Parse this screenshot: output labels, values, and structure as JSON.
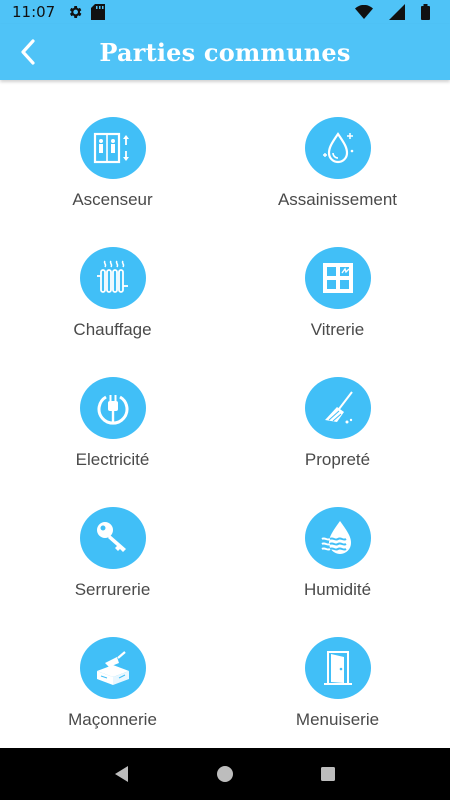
{
  "status_bar": {
    "time": "11:07",
    "icons": [
      "gear-icon",
      "sd-card-icon",
      "wifi-icon",
      "signal-icon",
      "battery-icon"
    ]
  },
  "app_bar": {
    "title": "Parties communes",
    "back_icon": "chevron-left-icon",
    "background": "#4fc3f7"
  },
  "accent_color": "#41bff7",
  "categories": [
    {
      "label": "Ascenseur",
      "icon": "elevator-icon"
    },
    {
      "label": "Assainissement",
      "icon": "water-drop-icon"
    },
    {
      "label": "Chauffage",
      "icon": "radiator-icon"
    },
    {
      "label": "Vitrerie",
      "icon": "window-icon"
    },
    {
      "label": "Electricité",
      "icon": "electric-plug-icon"
    },
    {
      "label": "Propreté",
      "icon": "broom-icon"
    },
    {
      "label": "Serrurerie",
      "icon": "key-icon"
    },
    {
      "label": "Humidité",
      "icon": "humidity-icon"
    },
    {
      "label": "Maçonnerie",
      "icon": "masonry-trowel-icon"
    },
    {
      "label": "Menuiserie",
      "icon": "door-icon"
    }
  ],
  "nav_bar": {
    "buttons": [
      "back-triangle-icon",
      "home-circle-icon",
      "recents-square-icon"
    ]
  }
}
